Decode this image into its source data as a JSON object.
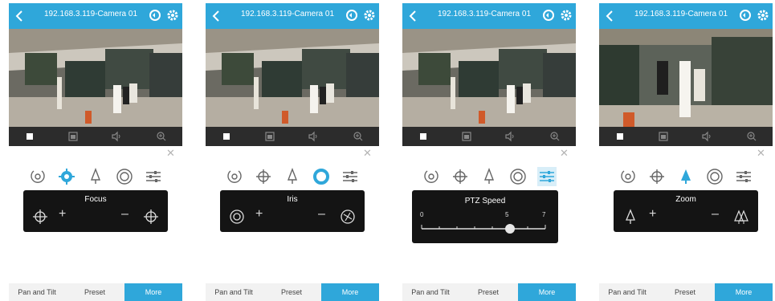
{
  "colors": {
    "accent": "#2fa7da",
    "panel": "#141414",
    "video_bar": "#2c2c2c"
  },
  "screens": [
    {
      "header": {
        "title": "192.168.3.119-Camera 01"
      },
      "control_label": "Focus",
      "active_tool": "focus",
      "tabs": [
        "Pan and Tilt",
        "Preset",
        "More"
      ],
      "active_tab": "More"
    },
    {
      "header": {
        "title": "192.168.3.119-Camera 01"
      },
      "control_label": "Iris",
      "active_tool": "iris",
      "tabs": [
        "Pan and Tilt",
        "Preset",
        "More"
      ],
      "active_tab": "More"
    },
    {
      "header": {
        "title": "192.168.3.119-Camera 01"
      },
      "control_label": "PTZ Speed",
      "active_tool": "ptz-speed",
      "speed": {
        "min_label": "0",
        "mid_label": "5",
        "max_label": "7",
        "value": 5
      },
      "tabs": [
        "Pan and Tilt",
        "Preset",
        "More"
      ],
      "active_tab": "More"
    },
    {
      "header": {
        "title": "192.168.3.119-Camera 01"
      },
      "control_label": "Zoom",
      "active_tool": "zoom",
      "tabs": [
        "Pan and Tilt",
        "Preset",
        "More"
      ],
      "active_tab": "More"
    }
  ]
}
